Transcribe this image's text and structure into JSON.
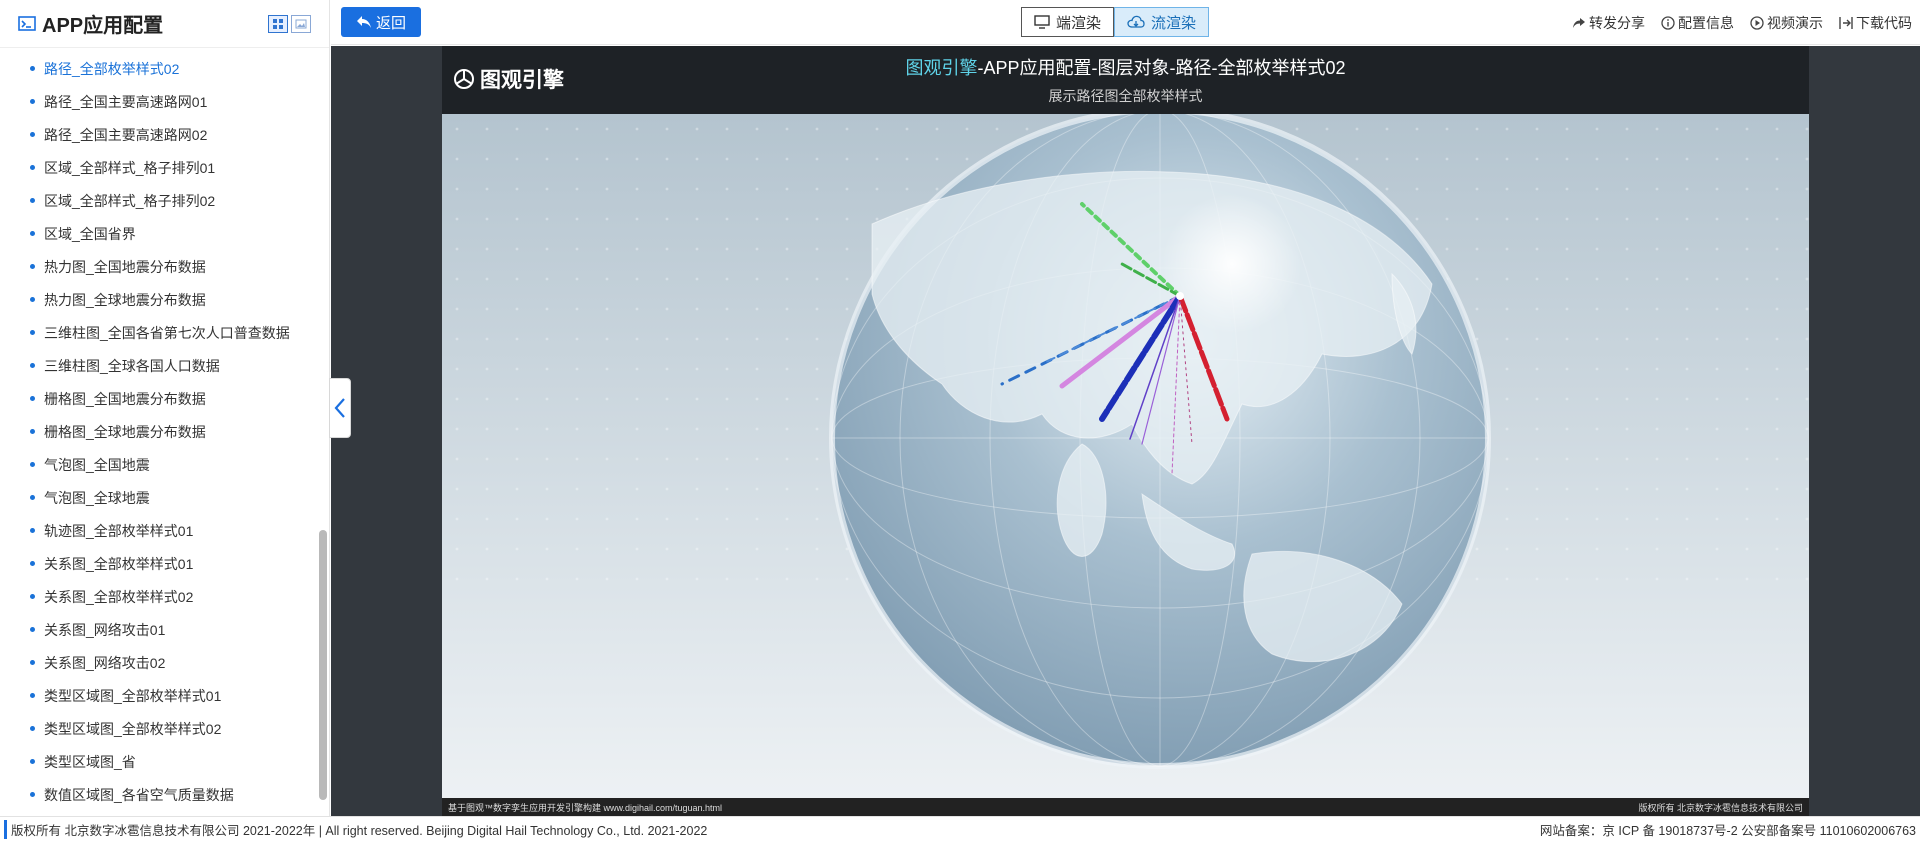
{
  "sidebar": {
    "title": "APP应用配置",
    "items": [
      "路径_全部枚举样式02",
      "路径_全国主要高速路网01",
      "路径_全国主要高速路网02",
      "区域_全部样式_格子排列01",
      "区域_全部样式_格子排列02",
      "区域_全国省界",
      "热力图_全国地震分布数据",
      "热力图_全球地震分布数据",
      "三维柱图_全国各省第七次人口普查数据",
      "三维柱图_全球各国人口数据",
      "栅格图_全国地震分布数据",
      "栅格图_全球地震分布数据",
      "气泡图_全国地震",
      "气泡图_全球地震",
      "轨迹图_全部枚举样式01",
      "关系图_全部枚举样式01",
      "关系图_全部枚举样式02",
      "关系图_网络攻击01",
      "关系图_网络攻击02",
      "类型区域图_全部枚举样式01",
      "类型区域图_全部枚举样式02",
      "类型区域图_省",
      "数值区域图_各省空气质量数据"
    ]
  },
  "toolbar": {
    "back_label": "返回",
    "render_client": "端渲染",
    "render_stream": "流渲染",
    "share": "转发分享",
    "config_info": "配置信息",
    "video_demo": "视频演示",
    "download_code": "下载代码"
  },
  "viewer": {
    "logo": "图观引擎",
    "title_accent": "图观引擎",
    "title_rest": "-APP应用配置-图层对象-路径-全部枚举样式02",
    "subtitle": "展示路径图全部枚举样式",
    "foot_left": "基于图观™数字孪生应用开发引擎构建 www.digihail.com/tuguan.html",
    "foot_right": "版权所有 北京数字冰雹信息技术有限公司"
  },
  "footer": {
    "left": "版权所有 北京数字冰雹信息技术有限公司 2021-2022年 | All right reserved. Beijing Digital Hail Technology Co., Ltd. 2021-2022",
    "right": "网站备案：京 ICP 备 19018737号-2 公安部备案号 11010602006763"
  },
  "colors": {
    "accent": "#1a6fe0",
    "title_accent": "#5fd3e8"
  }
}
